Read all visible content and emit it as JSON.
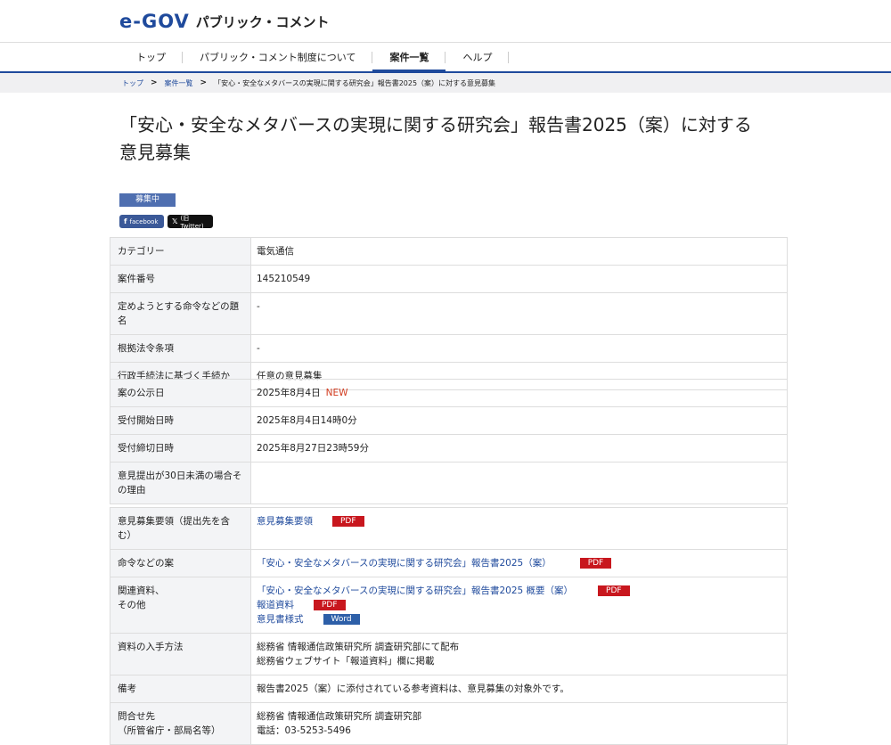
{
  "header": {
    "logo_mark": "e-GOV",
    "logo_text": "パブリック・コメント"
  },
  "nav": {
    "items": [
      "トップ",
      "パブリック・コメント制度について",
      "案件一覧",
      "ヘルプ"
    ],
    "active": "案件一覧"
  },
  "breadcrumb": {
    "items": [
      "トップ",
      "案件一覧"
    ],
    "current": "「安心・安全なメタバースの実現に関する研究会」報告書2025（案）に対する意見募集"
  },
  "page": {
    "title_line1": "「安心・安全なメタバースの実現に関する研究会」報告書2025（案）に対する",
    "title_line2": "意見募集",
    "status": "募集中",
    "share_facebook": "facebook",
    "share_twitter": "(旧Twitter)"
  },
  "table1": {
    "rows": [
      {
        "label": "カテゴリー",
        "value": "電気通信"
      },
      {
        "label": "案件番号",
        "value": "145210549"
      },
      {
        "label": "定めようとする命令などの題名",
        "value": "-"
      },
      {
        "label": "根拠法令条項",
        "value": "-"
      },
      {
        "label": "行政手続法に基づく手続か",
        "value": "任意の意見募集"
      }
    ]
  },
  "table2": {
    "rows": [
      {
        "label": "案の公示日",
        "value": "2025年8月4日",
        "badge": "NEW"
      },
      {
        "label": "受付開始日時",
        "value": "2025年8月4日14時0分"
      },
      {
        "label": "受付締切日時",
        "value": "2025年8月27日23時59分"
      },
      {
        "label": "意見提出が30日未満の場合その理由",
        "value": ""
      }
    ]
  },
  "table3": {
    "youryou_label": "意見募集要領（提出先を含む）",
    "youryou_link": "意見募集要領",
    "meirei_label": "命令などの案",
    "meirei_link": "「安心・安全なメタバースの実現に関する研究会」報告書2025（案）",
    "kanren_label_1": "関連資料、",
    "kanren_label_2": "その他",
    "kanren_link_1": "「安心・安全なメタバースの実現に関する研究会」報告書2025 概要（案）",
    "kanren_link_2": "報道資料",
    "kanren_link_3": "意見書様式",
    "nyushu_label": "資料の入手方法",
    "nyushu_line_1": "総務省 情報通信政策研究所 調査研究部にて配布",
    "nyushu_line_2": "総務省ウェブサイト「報道資料」欄に掲載",
    "biko_label": "備考",
    "biko_value": "報告書2025（案）に添付されている参考資料は、意見募集の対象外です。",
    "toiawase_label_1": "問合せ先",
    "toiawase_label_2": "（所管省庁・部局名等）",
    "toiawase_line_1": "総務省 情報通信政策研究所 調査研究部",
    "toiawase_line_2": "電話：03-5253-5496",
    "pdf": "PDF",
    "word": "Word"
  },
  "colors": {
    "brand": "#1f4a9c",
    "status": "#4f6fb0",
    "pdf": "#c8171e",
    "word": "#2d5fa8",
    "new": "#d23b1f"
  }
}
